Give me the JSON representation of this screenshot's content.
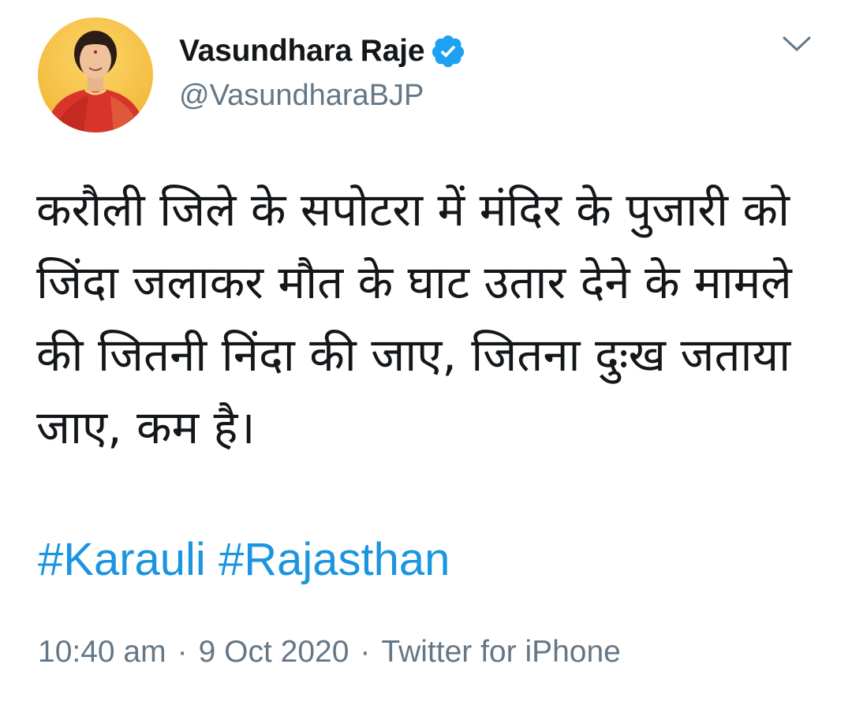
{
  "author": {
    "name": "Vasundhara Raje",
    "handle": "@VasundharaBJP",
    "verified": true
  },
  "tweet": {
    "text": "करौली जिले के सपोटरा में मंदिर के पुजारी को जिंदा जलाकर मौत के घाट उतार देने के मामले की जितनी निंदा की जाए, जितना दुःख जताया जाए, कम है।",
    "hashtags": [
      "#Karauli",
      "#Rajasthan"
    ]
  },
  "meta": {
    "time": "10:40 am",
    "date": "9 Oct 2020",
    "separator": "·",
    "source": "Twitter for iPhone"
  },
  "icons": {
    "verified": "verified-badge-icon",
    "menu": "chevron-down-icon"
  },
  "colors": {
    "link": "#1b95e0",
    "verified": "#1da1f2",
    "secondary_text": "#657786",
    "primary_text": "#14171a",
    "avatar_background": "#f5c242",
    "saree": "#d9342b"
  }
}
